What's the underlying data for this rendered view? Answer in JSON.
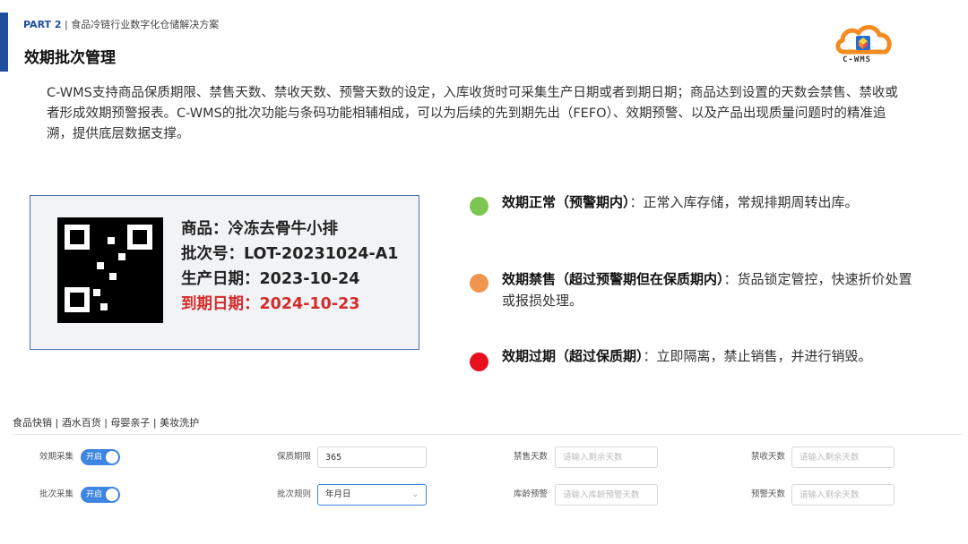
{
  "header": {
    "part_num": "PART 2",
    "part_sep": " | ",
    "part_topic": "食品冷链行业数字化仓储解决方案",
    "title": "效期批次管理",
    "logo_text": "C-WMS",
    "logo_icon": "cloud-box-logo-icon"
  },
  "description": "C-WMS支持商品保质期限、禁售天数、禁收天数、预警天数的设定，入库收货时可采集生产日期或者到期日期；商品达到设置的天数会禁售、禁收或者形成效期预警报表。C-WMS的批次功能与条码功能相辅相成，可以为后续的先到期先出（FEFO）、效期预警、以及产品出现质量问题时的精准追溯，提供底层数据支撑。",
  "label_card": {
    "qr_icon": "qr-code-icon",
    "product": "商品：冷冻去骨牛小排",
    "batch": "批次号：LOT-20231024-A1",
    "production_date": "生产日期：2023-10-24",
    "expiry_date": "到期日期：2024-10-23",
    "expiry_color": "#d42b2b"
  },
  "legend": [
    {
      "color": "#7cc653",
      "title": "效期正常（预警期内）",
      "sep": "：",
      "desc": "正常入库存储，常规排期周转出库。"
    },
    {
      "color": "#f0954f",
      "title": "效期禁售（超过预警期但在保质期内）",
      "sep": "：",
      "desc": "货品锁定管控，快速折价处置或报损处理。"
    },
    {
      "color": "#e8101c",
      "title": "效期过期（超过保质期）",
      "sep": "：",
      "desc": "立即隔离，禁止销售，并进行销毁。"
    }
  ],
  "industries": "食品快销 | 酒水百货 | 母婴亲子 | 美妆洗护",
  "form": {
    "row1": {
      "expiry_collect_label": "效期采集",
      "expiry_collect_toggle": "开启",
      "shelf_life_label": "保质期限",
      "shelf_life_value": "365",
      "no_sale_label": "禁售天数",
      "no_sale_placeholder": "请输入剩余天数",
      "no_receive_label": "禁收天数",
      "no_receive_placeholder": "请输入剩余天数"
    },
    "row2": {
      "batch_collect_label": "批次采集",
      "batch_collect_toggle": "开启",
      "batch_rule_label": "批次规则",
      "batch_rule_value": "年月日",
      "stock_age_label": "库龄预警",
      "stock_age_placeholder": "请输入库龄预警天数",
      "warn_days_label": "预警天数",
      "warn_days_placeholder": "请输入剩余天数"
    }
  },
  "colors": {
    "brand": "#1f4e9c",
    "toggle_on": "#3d85e0",
    "logo_orange": "#f58a1f"
  }
}
